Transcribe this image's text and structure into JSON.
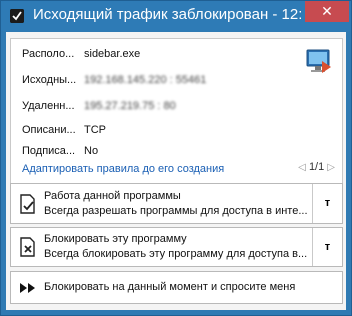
{
  "window": {
    "title": "Исходящий трафик заблокирован - 12:...",
    "close_label": "✕"
  },
  "info": {
    "location_label": "Располо...",
    "location_value": "sidebar.exe",
    "source_label": "Исходны...",
    "source_value": "192.168.145.220 : 55461",
    "remote_label": "Удаленн...",
    "remote_value": "195.27.219.75 : 80",
    "description_label": "Описани...",
    "description_value": "TCP",
    "signed_label": "Подписа...",
    "signed_value": "No",
    "adapt_link": "Адаптировать правила до его создания",
    "pager": "1/1",
    "icon": "monitor-shield-icon"
  },
  "actions": [
    {
      "title": "Работа данной программы",
      "subtitle": "Всегда разрешать программы для доступа в инте...",
      "side": "т",
      "icon": "allow-document-icon"
    },
    {
      "title": "Блокировать эту программу",
      "subtitle": "Всегда блокировать эту программу для доступа в...",
      "side": "т",
      "icon": "block-document-icon"
    },
    {
      "title": "Блокировать на данный момент и спросите меня",
      "icon": "double-arrow-icon"
    }
  ]
}
